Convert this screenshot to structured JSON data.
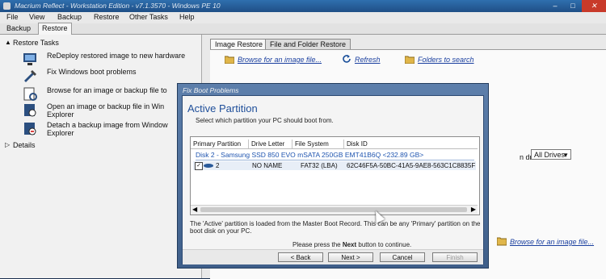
{
  "window": {
    "title": "Macrium Reflect - Workstation Edition - v7.1.3570 - Windows PE 10"
  },
  "menu": [
    "File",
    "View",
    "Backup",
    "Restore",
    "Other Tasks",
    "Help"
  ],
  "tabs": [
    {
      "label": "Backup"
    },
    {
      "label": "Restore"
    }
  ],
  "left": {
    "restore_tasks_header": "Restore Tasks",
    "tasks": [
      {
        "line1": "ReDeploy restored image to new hardware",
        "line2": ""
      },
      {
        "line1": "Fix Windows boot problems",
        "line2": ""
      },
      {
        "line1": "Browse for an image or backup file to",
        "line2": ""
      },
      {
        "line1": "Open an image or backup file in Win",
        "line2": "Explorer"
      },
      {
        "line1": "Detach a backup image from Window",
        "line2": "Explorer"
      }
    ],
    "details_header": "Details"
  },
  "right": {
    "tabs": [
      {
        "label": "Image Restore"
      },
      {
        "label": "File and Folder Restore"
      }
    ],
    "toolbar": {
      "browse": "Browse for an image file...",
      "refresh": "Refresh",
      "folders": "Folders to search"
    },
    "drive_label": "n drive:",
    "drive_value": "All Drives",
    "browse_link": "Browse for an image file..."
  },
  "dialog": {
    "title": "Fix Boot Problems",
    "heading": "Active Partition",
    "subheading": "Select which partition your PC should boot from.",
    "columns": [
      "Primary Partition",
      "Drive Letter",
      "File System",
      "Disk ID"
    ],
    "disk_group": "Disk 2 - Samsung SSD 850 EVO mSATA 250GB EMT41B6Q  <232.89 GB>",
    "row": {
      "partition": "2",
      "drive_letter": "NO NAME",
      "file_system": "FAT32 (LBA)",
      "disk_id": "62C46F5A-50BC-41A5-9AE8-563C1C8835F"
    },
    "note": "The 'Active' partition is loaded from the Master Boot Record. This can be any 'Primary' partition on the boot disk on your PC.",
    "press_pre": "Please press the",
    "press_bold": "Next",
    "press_post": "button to continue.",
    "buttons": {
      "back": "< Back",
      "next": "Next >",
      "cancel": "Cancel",
      "finish": "Finish"
    }
  },
  "colors": {
    "accent": "#1f4f9a",
    "link": "#1a3f9f",
    "titlebar": "#2f6fae",
    "close": "#c83a2a"
  }
}
